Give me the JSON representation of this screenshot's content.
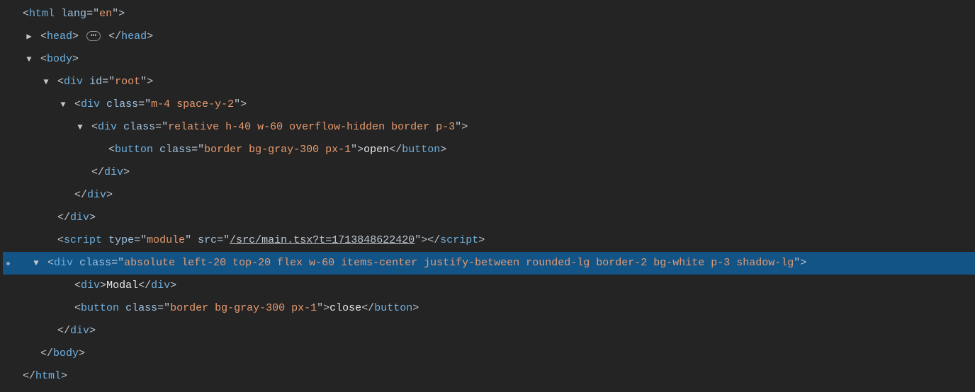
{
  "glyphs": {
    "arrow_down": "▼",
    "arrow_right": "▶",
    "ellipsis": "⋯"
  },
  "l1": {
    "open": "<",
    "tag": "html",
    "sp": " ",
    "attr": "lang",
    "eq": "=\"",
    "val": "en",
    "q": "\"",
    "close": ">"
  },
  "l2": {
    "open": "<",
    "tag": "head",
    "close": ">",
    "sp": " ",
    "open2": "</",
    "tag2": "head",
    "close2": ">"
  },
  "l3": {
    "open": "<",
    "tag": "body",
    "close": ">"
  },
  "l4": {
    "open": "<",
    "tag": "div",
    "sp": " ",
    "attr": "id",
    "eq": "=\"",
    "val": "root",
    "q": "\"",
    "close": ">"
  },
  "l5": {
    "open": "<",
    "tag": "div",
    "sp": " ",
    "attr": "class",
    "eq": "=\"",
    "val": "m-4 space-y-2",
    "q": "\"",
    "close": ">"
  },
  "l6": {
    "open": "<",
    "tag": "div",
    "sp": " ",
    "attr": "class",
    "eq": "=\"",
    "val": "relative h-40 w-60 overflow-hidden border p-3",
    "q": "\"",
    "close": ">"
  },
  "l7": {
    "open": "<",
    "tag": "button",
    "sp": " ",
    "attr": "class",
    "eq": "=\"",
    "val": "border bg-gray-300 px-1",
    "q": "\"",
    "close": ">",
    "text": "open",
    "open2": "</",
    "tag2": "button",
    "close2": ">"
  },
  "l8": {
    "open": "</",
    "tag": "div",
    "close": ">"
  },
  "l9": {
    "open": "</",
    "tag": "div",
    "close": ">"
  },
  "l10": {
    "open": "</",
    "tag": "div",
    "close": ">"
  },
  "l11": {
    "open": "<",
    "tag": "script",
    "sp1": " ",
    "attr1": "type",
    "eq1": "=\"",
    "val1": "module",
    "q1": "\"",
    "sp2": " ",
    "attr2": "src",
    "eq2": "=\"",
    "val2": "/src/main.tsx?t=1713848622420",
    "q2": "\"",
    "close": ">",
    "open2": "</",
    "tag2": "script",
    "close2": ">"
  },
  "l12": {
    "open": "<",
    "tag": "div",
    "sp": " ",
    "attr": "class",
    "eq": "=\"",
    "val": "absolute left-20 top-20 flex w-60 items-center justify-between rounded-lg border-2 bg-white p-3 shadow-lg",
    "q": "\"",
    "close": ">"
  },
  "l13": {
    "open": "<",
    "tag": "div",
    "close": ">",
    "text": "Modal",
    "open2": "</",
    "tag2": "div",
    "close2": ">"
  },
  "l14": {
    "open": "<",
    "tag": "button",
    "sp": " ",
    "attr": "class",
    "eq": "=\"",
    "val": "border bg-gray-300 px-1",
    "q": "\"",
    "close": ">",
    "text": "close",
    "open2": "</",
    "tag2": "button",
    "close2": ">"
  },
  "l15": {
    "open": "</",
    "tag": "div",
    "close": ">"
  },
  "l16": {
    "open": "</",
    "tag": "body",
    "close": ">"
  },
  "l17": {
    "open": "</",
    "tag": "html",
    "close": ">"
  }
}
